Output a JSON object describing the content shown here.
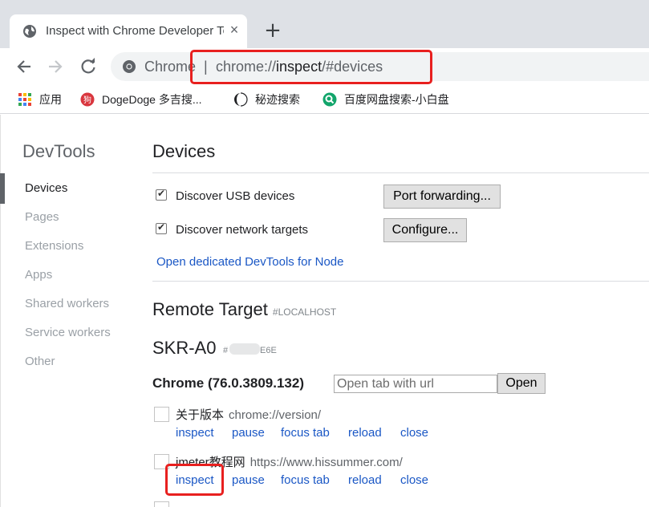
{
  "tab": {
    "title": "Inspect with Chrome Developer Tools",
    "close_icon": "×",
    "new_tab_icon": "+"
  },
  "omnibox": {
    "chip": "Chrome",
    "separator": "|",
    "url_scheme": "chrome://",
    "url_host": "inspect",
    "url_path": "/#devices"
  },
  "bookmarks": [
    {
      "label": "应用",
      "icon": "apps-grid-icon"
    },
    {
      "label": "DogeDoge 多吉搜...",
      "icon": "dogedoge-icon"
    },
    {
      "label": "秘迹搜索",
      "icon": "mijisou-icon"
    },
    {
      "label": "百度网盘搜索-小白盘",
      "icon": "xiaobaipan-icon"
    }
  ],
  "sidebar": {
    "title": "DevTools",
    "items": [
      "Devices",
      "Pages",
      "Extensions",
      "Apps",
      "Shared workers",
      "Service workers",
      "Other"
    ],
    "active": "Devices"
  },
  "devices": {
    "title": "Devices",
    "discover_usb": "Discover USB devices",
    "port_forwarding": "Port forwarding...",
    "discover_network": "Discover network targets",
    "configure": "Configure...",
    "node_link": "Open dedicated DevTools for Node"
  },
  "remote": {
    "title": "Remote Target",
    "tag": "#LOCALHOST",
    "device_name": "SKR-A0",
    "serial_prefix": "#",
    "serial_suffix": "E6E",
    "browser": "Chrome (76.0.3809.132)",
    "url_placeholder": "Open tab with url",
    "open_button": "Open",
    "targets": [
      {
        "title": "关于版本",
        "url": "chrome://version/"
      },
      {
        "title": "jmeter教程网",
        "url": "https://www.hissummer.com/"
      }
    ],
    "actions": [
      "inspect",
      "pause",
      "focus tab",
      "reload",
      "close"
    ]
  },
  "colors": {
    "highlight": "#e8201f",
    "link": "#1a57c5"
  }
}
